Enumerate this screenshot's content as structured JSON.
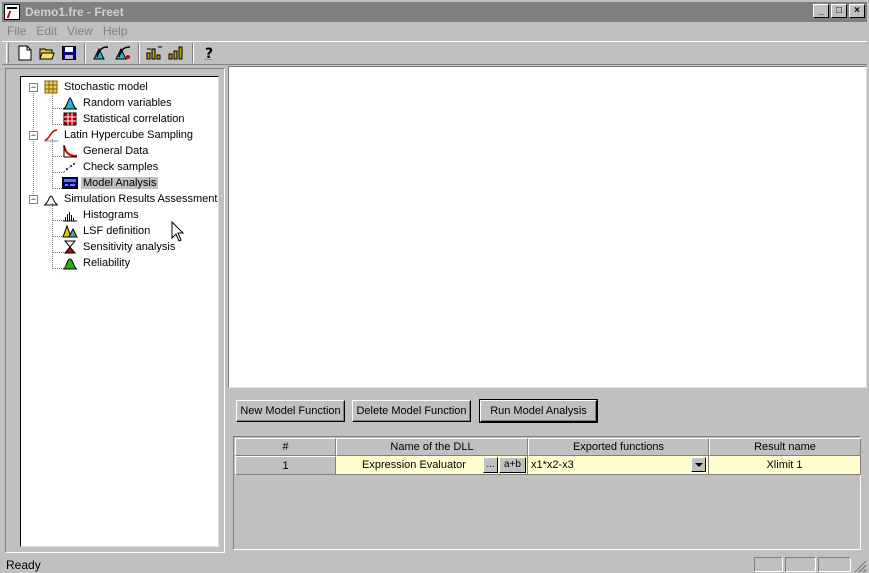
{
  "window": {
    "title": "Demo1.fre - Freet",
    "controls": {
      "minimize": "_",
      "maximize": "□",
      "close": "×"
    }
  },
  "menu": [
    "File",
    "Edit",
    "View",
    "Help"
  ],
  "toolbar": {
    "icons": [
      "new-file-icon",
      "open-folder-icon",
      "save-icon",
      "lhs-icon",
      "lhs-run-icon",
      "chart-icon",
      "chart-2-icon",
      "help-icon"
    ]
  },
  "tree": {
    "groups": [
      {
        "label": "Stochastic model",
        "icon": "grid-icon",
        "expander": "−",
        "children": [
          {
            "label": "Random variables",
            "icon": "distribution-icon"
          },
          {
            "label": "Statistical correlation",
            "icon": "correlation-matrix-icon"
          }
        ]
      },
      {
        "label": "Latin Hypercube Sampling",
        "icon": "lhs-curve-icon",
        "expander": "−",
        "children": [
          {
            "label": "General Data",
            "icon": "general-data-icon"
          },
          {
            "label": "Check samples",
            "icon": "check-samples-icon"
          },
          {
            "label": "Model Analysis",
            "icon": "model-analysis-icon",
            "selected": true
          }
        ]
      },
      {
        "label": "Simulation Results Assessment",
        "icon": "results-icon",
        "expander": "−",
        "children": [
          {
            "label": "Histograms",
            "icon": "histogram-icon"
          },
          {
            "label": "LSF definition",
            "icon": "lsf-icon"
          },
          {
            "label": "Sensitivity analysis",
            "icon": "sensitivity-icon"
          },
          {
            "label": "Reliability",
            "icon": "reliability-icon"
          }
        ]
      }
    ]
  },
  "buttons": {
    "new_model": "New Model Function",
    "delete_model": "Delete Model Function",
    "run_analysis": "Run Model Analysis"
  },
  "grid": {
    "headers": [
      "#",
      "Name of the DLL",
      "Exported functions",
      "Result name"
    ],
    "rows": [
      {
        "num": "1",
        "dll": "Expression Evaluator",
        "browse": "...",
        "expr_button": "a+b",
        "function": "x1*x2-x3",
        "result": "Xlimit 1"
      }
    ]
  },
  "status": {
    "text": "Ready"
  }
}
